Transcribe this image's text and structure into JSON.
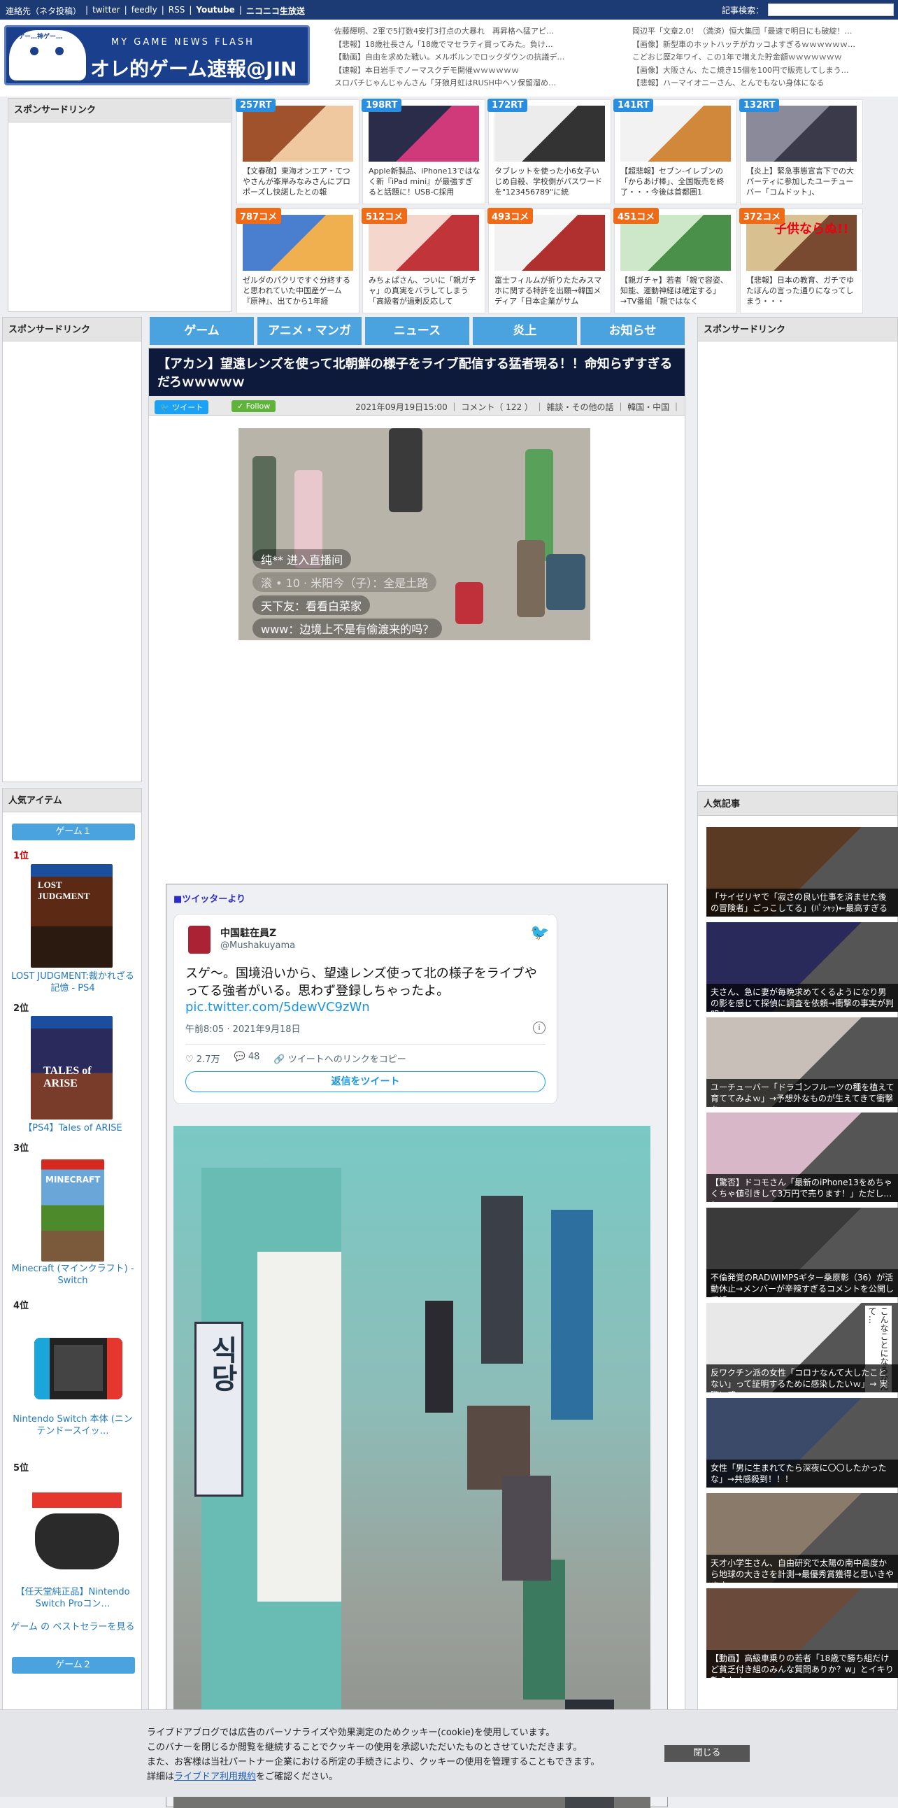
{
  "topbar": {
    "links": [
      "連絡先（ネタ投稿）",
      "twitter",
      "feedly",
      "RSS",
      "Youtube",
      "ニコニコ生放送"
    ],
    "search_label": "記事検索："
  },
  "logo": {
    "small": "MY GAME NEWS FLASH",
    "big": "オレ的ゲーム速報@JIN",
    "mascot_text": "神ゲー…神ゲー…"
  },
  "news_left": [
    "佐藤輝明、2軍で5打数4安打3打点の大暴れ　再昇格へ猛アピ…",
    "【悲報】18歳社長さん「18歳でマセラティ買ってみた。負け…",
    "【動画】自由を求めた戦い。メルボルンでロックダウンの抗議デ…",
    "【速報】本日岩手でノーマスクデモ開催ｗｗｗｗｗｗ",
    "スロパチじゃんじゃんさん「牙狼月虹はRUSH中ヘソ保留溜め…"
  ],
  "news_right": [
    "岡辺平「文章2.0！（満済）恒大集団「最速で明日にも破綻！…",
    "【画像】新型車のホットハッチがカッコよすぎるｗｗｗｗｗｗ…",
    "こどおじ歴2年ワイ、この1年で増えた貯金額ｗｗｗｗｗｗｗ",
    "【画像】大阪さん、たこ焼き15個を100円で販売してしまう…",
    "【悲報】ハーマイオニーさん、とんでもない身体になる"
  ],
  "sponsor_label": "スポンサードリンク",
  "thumbs": [
    {
      "badge": "257RT",
      "text": "【文春砲】東海オンエア・てつやさんが峯岸みなみさんにプロポーズし快諾したとの報"
    },
    {
      "badge": "198RT",
      "text": "Apple新製品、iPhone13ではなく新『iPad mini』が最強すぎると話題に！USB-C採用"
    },
    {
      "badge": "172RT",
      "text": "タブレットを使った小6女子いじめ自殺、学校側がパスワードを\"123456789\"に統"
    },
    {
      "badge": "141RT",
      "text": "【超悲報】セブン-イレブンの「からあげ棒」、全国販売を終了・・・今後は首都圏1"
    },
    {
      "badge": "132RT",
      "text": "【炎上】緊急事態宣言下での大パーティに参加したユーチューバー「コムドット」、"
    },
    {
      "badge": "787コメ",
      "text": "ゼルダのパクリですぐ分終すると思われていた中国産ゲーム『原神』、出てから1年経"
    },
    {
      "badge": "512コメ",
      "text": "みちょぱさん、ついに「親ガチャ」の真実をバラしてしまう「高級者が過剰反応して"
    },
    {
      "badge": "493コメ",
      "text": "富士フィルムが折りたたみスマホに関する特許を出願→韓国メディア「日本企業がサム"
    },
    {
      "badge": "451コメ",
      "text": "【親ガチャ】若者「親で容姿、知能、運動神経は確定する」→TV番組「親ではなく"
    },
    {
      "badge": "372コメ",
      "text": "【悲報】日本の教育、ガチでゆたぼんの言った通りになってしまう・・・"
    }
  ],
  "thumb_overlay_text": "子供ならぬ!!",
  "nav": [
    "ゲーム",
    "アニメ・マンガ",
    "ニュース",
    "炎上",
    "お知らせ"
  ],
  "article": {
    "title": "【アカン】望遠レンズを使って北朝鮮の様子をライブ配信する猛者現る！！命知らずすぎるだろｗｗｗｗｗ",
    "tweet_btn": "ツイート",
    "follow_btn": "Follow",
    "meta": "2021年09月19日15:00 ｜ コメント（ 122 ） ｜ 雑談・その他の話 ｜ 韓国・中国 ｜",
    "captions": [
      "纯** 进入直播间",
      "",
      "天下友：看看白菜家",
      "www：边境上不是有偷渡来的吗？"
    ],
    "caption_blur": "滚 • 10 · 米阳今（子）：全是土路"
  },
  "twitter": {
    "label": "■ツイッターより",
    "name": "中国駐在員Z",
    "handle": "@Mushakuyama",
    "text": "スゲ〜。国境沿いから、望遠レンズ使って北の様子をライブやってる強者がいる。思わず登録しちゃったよ。",
    "link": "pic.twitter.com/5dewVC9zWn",
    "date": "午前8:05 · 2021年9月18日",
    "likes": "2.7万",
    "replies": "48",
    "copy": "ツイートへのリンクをコピー",
    "reply_btn": "返信をツイート",
    "photo_sign": "식당"
  },
  "left": {
    "popular_items": "人気アイテム",
    "game1": "ゲーム１",
    "game2": "ゲーム２",
    "ranks": [
      "1位",
      "2位",
      "3位",
      "4位",
      "5位"
    ],
    "products": [
      "LOST JUDGMENT:裁かれざる記憶 - PS4",
      "【PS4】Tales of ARISE",
      "Minecraft (マインクラフト) - Switch",
      "Nintendo Switch 本体 (ニンテンドースイッ…",
      "【任天堂純正品】Nintendo Switch Proコン…"
    ],
    "bestseller": "ゲーム の ベストセラーを見る"
  },
  "right": {
    "popular_articles": "人気記事",
    "articles": [
      "「サイゼリヤで「寂さの良い仕事を済ませた後の冒険者」ごっこしてる」(ﾊﾟｼｬｯ)←最高すぎるｗｗｗ",
      "夫さん、急に妻が毎晩求めてくるようになり男の影を感じて探偵に調査を依頼→衝撃の事実が判明す",
      "ユーチューバー「ドラゴンフルーツの種を植えて育ててみよｗ」→予想外なものが生えてきて衝撃を",
      "【驚否】ドコモさん「最新のiPhone13をめちゃくちゃ値引きして3万円で売ります！」ただし…と",
      "不倫発覚のRADWIMPSギター桑原彰（36）が活動休止→メンバーが辛辣すぎるコメントを公開して話",
      "反ワクチン派の女性「コロナなんて大したことない」って証明するために感染したいｗ」→ 実際に感",
      "女性「男に生まれてたら深夜に〇〇したかったな」→共感殺到！！！",
      "天才小学生さん、自由研究で太陽の南中高度から地球の大きさを計測→最優秀賞獲得と思いきやまさ",
      "【動画】高級車乗りの若者「18歳で勝ち組だけど貧乏付き組のみんな質問ありか？w」とイキり散らかすー"
    ],
    "manga_text": "こんなことになるなんて…"
  },
  "cookie": {
    "lines": [
      "ライブドアブログでは広告のパーソナライズや効果測定のためクッキー(cookie)を使用しています。",
      "このバナーを閉じるか閲覧を継続することでクッキーの使用を承認いただいたものとさせていただきます。",
      "また、お客様は当社パートナー企業における所定の手続きにより、クッキーの使用を管理することもできます。"
    ],
    "line4_pre": "詳細は",
    "line4_link": "ライブドア利用規約",
    "line4_post": "をご確認ください。",
    "close": "閉じる"
  }
}
